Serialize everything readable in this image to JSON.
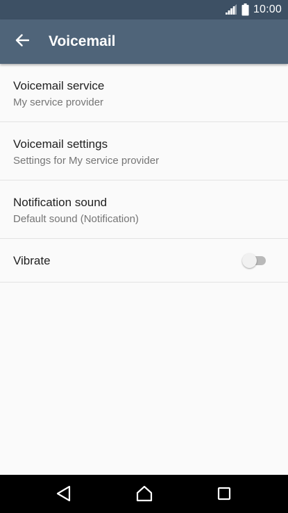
{
  "status_bar": {
    "time": "10:00",
    "signal_icon": "signal-icon",
    "battery_icon": "battery-icon"
  },
  "app_bar": {
    "title": "Voicemail",
    "back_icon": "arrow-back-icon"
  },
  "settings": {
    "items": [
      {
        "title": "Voicemail service",
        "summary": "My service provider"
      },
      {
        "title": "Voicemail settings",
        "summary": "Settings for My service provider"
      },
      {
        "title": "Notification sound",
        "summary": "Default sound (Notification)"
      },
      {
        "title": "Vibrate",
        "toggle": "off"
      }
    ]
  },
  "nav_bar": {
    "back_icon": "nav-back-icon",
    "home_icon": "nav-home-icon",
    "recents_icon": "nav-recents-icon"
  },
  "colors": {
    "status_bar": "#3d5064",
    "app_bar": "#4f6479",
    "background": "#fafafa",
    "primary_text": "#212121",
    "secondary_text": "#757575",
    "divider": "#e2e2e2",
    "nav_bar": "#000000"
  }
}
